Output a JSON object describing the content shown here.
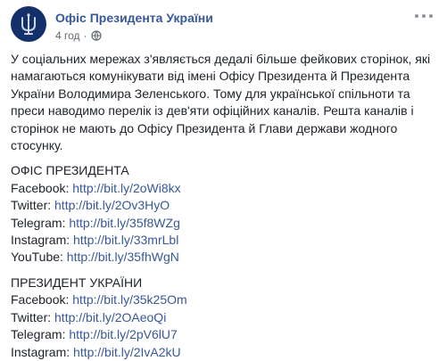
{
  "post": {
    "page_name": "Офіс Президента України",
    "time": "4 год",
    "separator": "·",
    "intro": "У соціальних мережах з'являється дедалі більше фейкових сторінок, які намагаються комунікувати від імені Офісу Президента й Президента України Володимира Зеленського. Тому для української спільноти та преси наводимо перелік із дев'яти офіційних каналів. Решта каналів і сторінок не мають до Офісу Президента й Глави держави жодного стосунку.",
    "sections": [
      {
        "title": "ОФІС ПРЕЗИДЕНТА",
        "links": [
          {
            "label": "Facebook:",
            "url": "http://bit.ly/2oWi8kx"
          },
          {
            "label": "Twitter:",
            "url": "http://bit.ly/2Ov3HyO"
          },
          {
            "label": "Telegram:",
            "url": "http://bit.ly/35f8WZg"
          },
          {
            "label": "Instagram:",
            "url": "http://bit.ly/33mrLbl"
          },
          {
            "label": "YouTube:",
            "url": "http://bit.ly/35fhWgN"
          }
        ]
      },
      {
        "title": "ПРЕЗИДЕНТ УКРАЇНИ",
        "links": [
          {
            "label": "Facebook:",
            "url": "http://bit.ly/35k25Om"
          },
          {
            "label": "Twitter:",
            "url": "http://bit.ly/2OAeoQi"
          },
          {
            "label": "Telegram:",
            "url": "http://bit.ly/2pV6lU7"
          },
          {
            "label": "Instagram:",
            "url": "http://bit.ly/2IvA2kU"
          }
        ]
      }
    ]
  },
  "icons": {
    "avatar": "trident-emblem-icon",
    "audience": "globe-icon",
    "options": "more-options-icon"
  },
  "colors": {
    "link": "#385898",
    "text": "#1d2129",
    "meta": "#616770",
    "avatar_bg": "#14306a"
  }
}
